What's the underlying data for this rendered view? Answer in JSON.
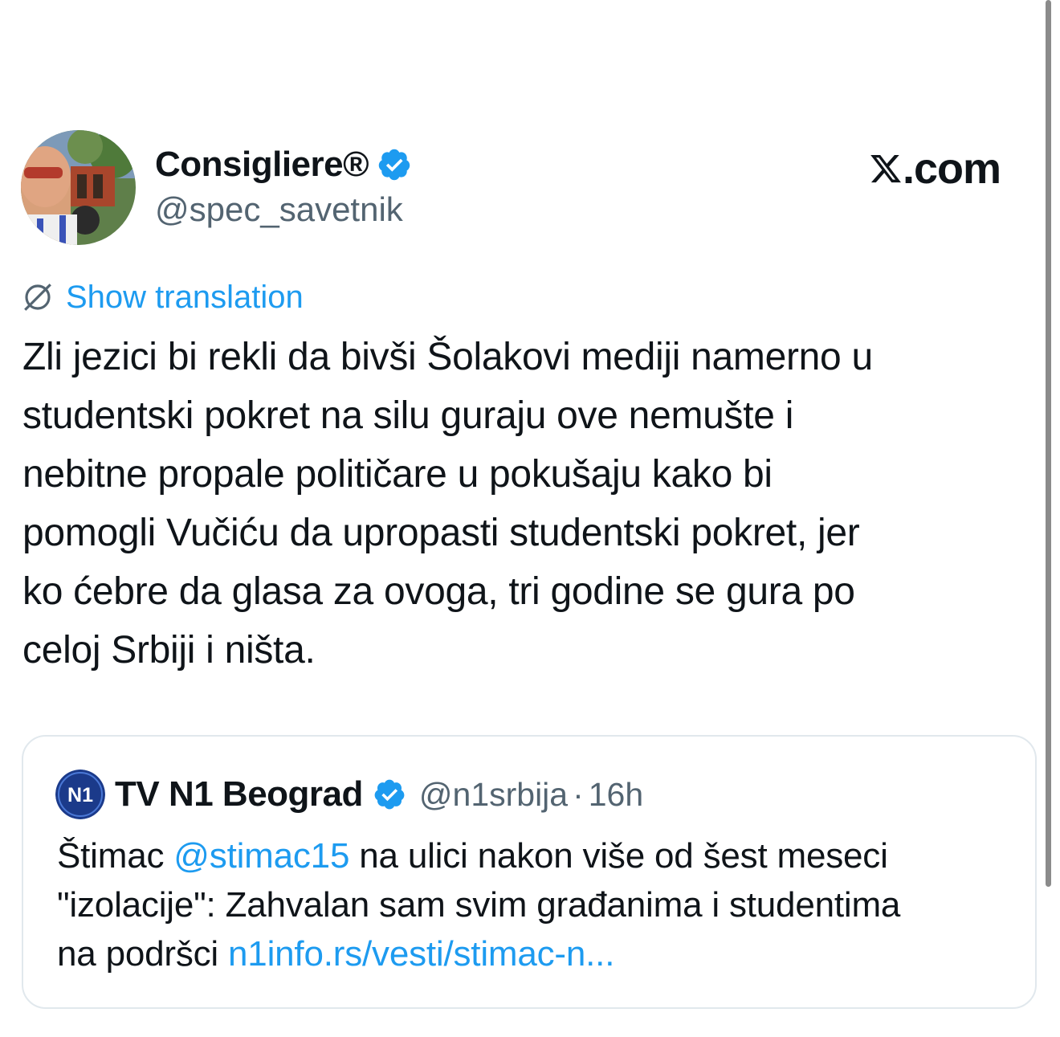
{
  "author": {
    "display_name": "Consigliere®",
    "handle": "@spec_savetnik",
    "verified": true,
    "avatar_icon": "profile-photo-avatar"
  },
  "brand": {
    "icon": "x-logo-icon",
    "text": ".com"
  },
  "translate": {
    "icon": "globe-off-icon",
    "label": "Show translation"
  },
  "tweet": {
    "lines": [
      "Zli jezici bi rekli da bivši Šolakovi mediji namerno u",
      "studentski pokret na silu guraju ove nemušte i",
      "nebitne propale političare u pokušaju kako bi",
      "pomogli Vučiću da upropasti studentski pokret, jer",
      "ko ćebre da glasa za ovoga, tri godine se gura po",
      "celoj Srbiji i ništa."
    ]
  },
  "quote": {
    "avatar_label": "N1",
    "display_name": "TV N1 Beograd",
    "verified": true,
    "handle": "@n1srbija",
    "separator": "·",
    "time": "16h",
    "text_line1_before": "Štimac ",
    "mention": "@stimac15",
    "text_line1_after": " na ulici nakon više od šest meseci",
    "text_line2": "\"izolacije\": Zahvalan sam svim građanima i studentima",
    "text_line3_before": "na podršci ",
    "link": "n1info.rs/vesti/stimac-n..."
  },
  "colors": {
    "accent": "#1d9bf0",
    "secondary_text": "#536471",
    "primary_text": "#0f1419",
    "card_border": "#e1e8ed",
    "n1_brand": "#1b3a8a"
  }
}
